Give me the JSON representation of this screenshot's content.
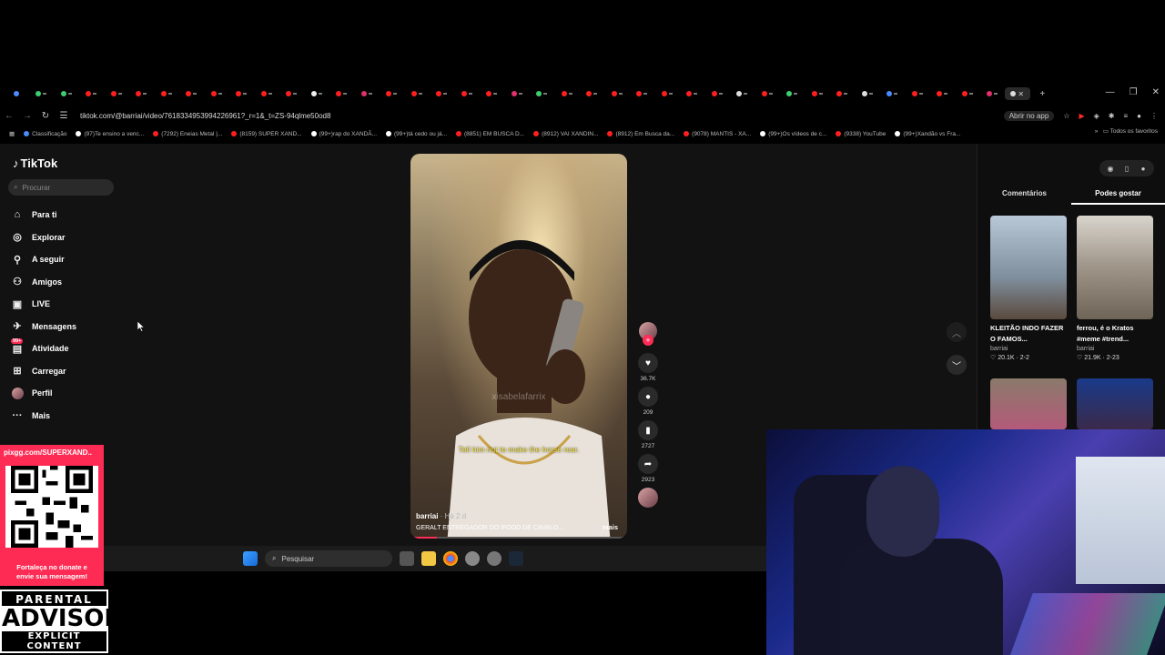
{
  "browser": {
    "url": "tiktok.com/@barriai/video/7618334953994226961?_r=1&_t=ZS-94qlme50od8",
    "open_app_label": "Abrir no app",
    "bookmarks": [
      "Classificação",
      "(97)Te ensino a venc...",
      "(7292) Eneias Metal |...",
      "(8159) SUPER XAND...",
      "(99+)rap do XANDÃ...",
      "(99+)tá cedo ou já...",
      "(8851) EM BUSCA D...",
      "(8912) VAI XANDIN...",
      "(8912) Em Busca da...",
      "(9078) MANTIS - XA...",
      "(99+)Os vídeos de c...",
      "(9338) YouTube",
      "(99+)Xandão vs Fra..."
    ],
    "bookmarks_all": "Todos os favoritos"
  },
  "tiktok": {
    "logo": "TikTok",
    "search_placeholder": "Procurar",
    "nav": [
      {
        "label": "Para ti",
        "icon": "home-icon"
      },
      {
        "label": "Explorar",
        "icon": "compass-icon"
      },
      {
        "label": "A seguir",
        "icon": "following-icon"
      },
      {
        "label": "Amigos",
        "icon": "friends-icon"
      },
      {
        "label": "LIVE",
        "icon": "live-icon"
      },
      {
        "label": "Mensagens",
        "icon": "messages-icon"
      },
      {
        "label": "Atividade",
        "icon": "activity-icon"
      },
      {
        "label": "Carregar",
        "icon": "upload-icon"
      },
      {
        "label": "Perfil",
        "icon": "profile-icon"
      },
      {
        "label": "Mais",
        "icon": "more-icon"
      }
    ],
    "activity_badge": "99+",
    "video": {
      "watermark": "xisabelafarrix",
      "caption": "Tell him not to make the horse rear.",
      "author": "barriai",
      "time": "· Há 2 d",
      "description": "GERALT ENTREGADOR DO IFOOD DE CAVALO...",
      "more": "mais",
      "progress": 0.12
    },
    "actions": {
      "likes": "36.7K",
      "comments": "209",
      "saves": "2727",
      "shares": "2923"
    },
    "panel": {
      "tabs": [
        "Comentários",
        "Podes gostar"
      ],
      "cards": [
        {
          "title": "KLEITÃO INDO FAZER O FAMOS...",
          "user": "barriai",
          "stats": "♡ 20.1K · 2-2"
        },
        {
          "title": "ferrou, é o Kratos #meme #trend...",
          "user": "barriai",
          "stats": "♡ 21.9K · 2-23"
        }
      ]
    }
  },
  "taskbar": {
    "search_placeholder": "Pesquisar"
  },
  "overlay": {
    "qr_url": "pixgg.com/SUPERXAND..",
    "qr_text_1": "Fortaleça no donate e",
    "qr_text_2": "envie sua mensagem!",
    "pa_1": "PARENTAL",
    "pa_2": "ADVISORY",
    "pa_3": "EXPLICIT CONTENT"
  },
  "colors": {
    "accent": "#fe2c55",
    "caption": "#f5e342"
  }
}
